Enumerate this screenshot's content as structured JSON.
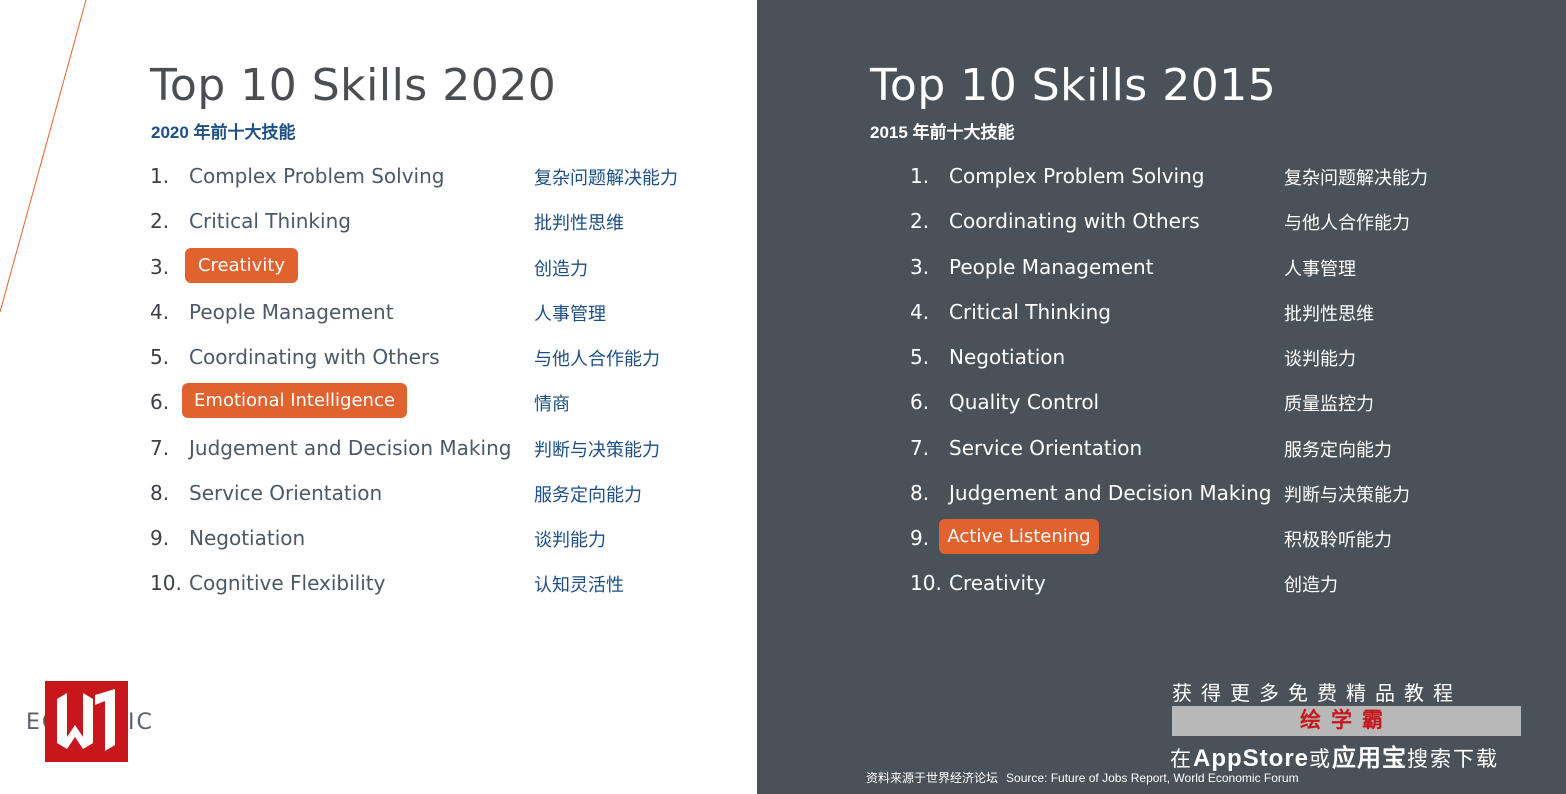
{
  "left": {
    "title": "Top 10 Skills 2020",
    "subtitle": "2020 年前十大技能",
    "items": [
      {
        "num": "1.",
        "skill": "Complex Problem Solving",
        "cn": "复杂问题解决能力"
      },
      {
        "num": "2.",
        "skill": "Critical Thinking",
        "cn": "批判性思维"
      },
      {
        "num": "3.",
        "skill": "Creativity",
        "cn": "创造力",
        "highlight": true
      },
      {
        "num": "4.",
        "skill": "People Management",
        "cn": "人事管理"
      },
      {
        "num": "5.",
        "skill": "Coordinating with Others",
        "cn": "与他人合作能力"
      },
      {
        "num": "6.",
        "skill": "Emotional Intelligence",
        "cn": "情商",
        "highlight": true
      },
      {
        "num": "7.",
        "skill": "Judgement and Decision Making",
        "cn": "判断与决策能力"
      },
      {
        "num": "8.",
        "skill": "Service Orientation",
        "cn": "服务定向能力"
      },
      {
        "num": "9.",
        "skill": "Negotiation",
        "cn": "谈判能力"
      },
      {
        "num": "10.",
        "skill": "Cognitive Flexibility",
        "cn": "认知灵活性"
      }
    ]
  },
  "right": {
    "title": "Top 10 Skills 2015",
    "subtitle": "2015 年前十大技能",
    "items": [
      {
        "num": "1.",
        "skill": "Complex Problem Solving",
        "cn": "复杂问题解决能力"
      },
      {
        "num": "2.",
        "skill": "Coordinating with Others",
        "cn": "与他人合作能力"
      },
      {
        "num": "3.",
        "skill": "People Management",
        "cn": "人事管理"
      },
      {
        "num": "4.",
        "skill": "Critical Thinking",
        "cn": "批判性思维"
      },
      {
        "num": "5.",
        "skill": "Negotiation",
        "cn": "谈判能力"
      },
      {
        "num": "6.",
        "skill": "Quality Control",
        "cn": "质量监控力"
      },
      {
        "num": "7.",
        "skill": "Service Orientation",
        "cn": "服务定向能力"
      },
      {
        "num": "8.",
        "skill": "Judgement and Decision Making",
        "cn": "判断与决策能力"
      },
      {
        "num": "9.",
        "skill": "Active Listening",
        "cn": "积极聆听能力",
        "highlight": true
      },
      {
        "num": "10.",
        "skill": "Creativity",
        "cn": "创造力"
      }
    ]
  },
  "logo": {
    "text_a": "EC",
    "text_b": "IC"
  },
  "promo": {
    "line1": "获得更多免费精品教程",
    "bar": "绘学霸",
    "line2_pre": "在",
    "line2_app": "AppStore",
    "line2_mid": "或",
    "line2_store": "应用宝",
    "line2_post": "搜索下载"
  },
  "source": {
    "cn": "资料来源于世界经济论坛",
    "en": "Source:  Future of Jobs Report, World Economic Forum"
  },
  "colors": {
    "highlight": "#e0622f",
    "dark_panel": "#4a5259",
    "cn_blue": "#1d4f86",
    "logo_red": "#c8161d"
  }
}
